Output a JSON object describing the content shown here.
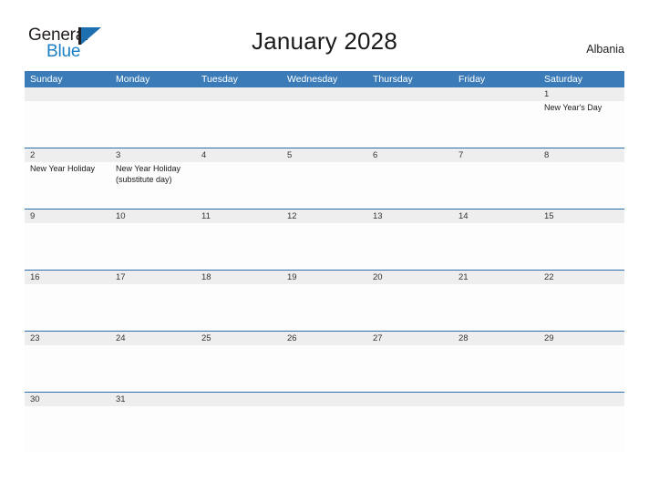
{
  "brand": {
    "name_part1": "General",
    "name_part2": "Blue",
    "triangle_color": "#1d6fb0",
    "text_color": "#231f20",
    "blue_text_color": "#1b7fc4"
  },
  "header": {
    "title": "January 2028",
    "country": "Albania"
  },
  "theme": {
    "header_blue": "#3b7cb8",
    "row_divider_blue": "#2a6ca8",
    "day_band_gray": "#eeeeee",
    "cell_white": "#fdfdfd"
  },
  "calendar": {
    "month": "January",
    "year": "2028",
    "weekdays": [
      "Sunday",
      "Monday",
      "Tuesday",
      "Wednesday",
      "Thursday",
      "Friday",
      "Saturday"
    ],
    "weeks": [
      [
        {
          "day": "",
          "events": []
        },
        {
          "day": "",
          "events": []
        },
        {
          "day": "",
          "events": []
        },
        {
          "day": "",
          "events": []
        },
        {
          "day": "",
          "events": []
        },
        {
          "day": "",
          "events": []
        },
        {
          "day": "1",
          "events": [
            "New Year's Day"
          ]
        }
      ],
      [
        {
          "day": "2",
          "events": [
            "New Year Holiday"
          ]
        },
        {
          "day": "3",
          "events": [
            "New Year Holiday (substitute day)"
          ]
        },
        {
          "day": "4",
          "events": []
        },
        {
          "day": "5",
          "events": []
        },
        {
          "day": "6",
          "events": []
        },
        {
          "day": "7",
          "events": []
        },
        {
          "day": "8",
          "events": []
        }
      ],
      [
        {
          "day": "9",
          "events": []
        },
        {
          "day": "10",
          "events": []
        },
        {
          "day": "11",
          "events": []
        },
        {
          "day": "12",
          "events": []
        },
        {
          "day": "13",
          "events": []
        },
        {
          "day": "14",
          "events": []
        },
        {
          "day": "15",
          "events": []
        }
      ],
      [
        {
          "day": "16",
          "events": []
        },
        {
          "day": "17",
          "events": []
        },
        {
          "day": "18",
          "events": []
        },
        {
          "day": "19",
          "events": []
        },
        {
          "day": "20",
          "events": []
        },
        {
          "day": "21",
          "events": []
        },
        {
          "day": "22",
          "events": []
        }
      ],
      [
        {
          "day": "23",
          "events": []
        },
        {
          "day": "24",
          "events": []
        },
        {
          "day": "25",
          "events": []
        },
        {
          "day": "26",
          "events": []
        },
        {
          "day": "27",
          "events": []
        },
        {
          "day": "28",
          "events": []
        },
        {
          "day": "29",
          "events": []
        }
      ],
      [
        {
          "day": "30",
          "events": []
        },
        {
          "day": "31",
          "events": []
        },
        {
          "day": "",
          "events": []
        },
        {
          "day": "",
          "events": []
        },
        {
          "day": "",
          "events": []
        },
        {
          "day": "",
          "events": []
        },
        {
          "day": "",
          "events": []
        }
      ]
    ]
  }
}
